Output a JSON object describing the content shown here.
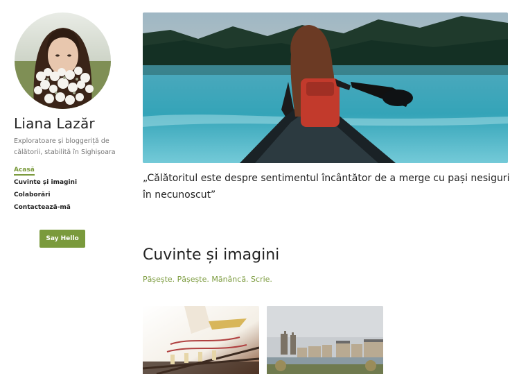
{
  "profile": {
    "name": "Liana Lazăr",
    "bio": "Exploratoare și bloggeriță de călătorii, stabilită în Sighișoara"
  },
  "nav": {
    "items": [
      {
        "label": "Acasă",
        "active": true
      },
      {
        "label": "Cuvinte și imagini",
        "active": false
      },
      {
        "label": "Colaborări",
        "active": false
      },
      {
        "label": "Contactează-mă",
        "active": false
      }
    ]
  },
  "cta": {
    "label": "Say Hello"
  },
  "hero": {
    "quote": "„Călătoritul este despre sentimentul încântător de a merge cu pași nesiguri în necunoscut”"
  },
  "section": {
    "title": "Cuvinte și imagini",
    "subtitle": "Pășește. Pășește. Mănâncă. Scrie."
  },
  "colors": {
    "accent": "#7a9a3c",
    "text": "#222222",
    "muted": "#777777"
  }
}
